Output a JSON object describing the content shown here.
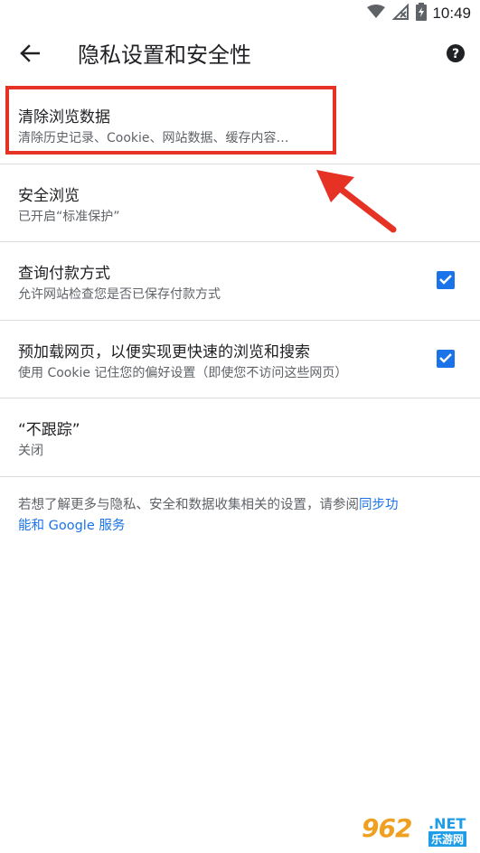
{
  "status_bar": {
    "time": "10:49",
    "icons": [
      "wifi-icon",
      "no-signal-icon",
      "battery-charging-icon"
    ]
  },
  "app_bar": {
    "back_icon": "arrow-left-icon",
    "title": "隐私设置和安全性",
    "help_icon": "help-circle-icon"
  },
  "settings": [
    {
      "title": "清除浏览数据",
      "subtitle": "清除历史记录、Cookie、网站数据、缓存内容…",
      "has_checkbox": false
    },
    {
      "title": "安全浏览",
      "subtitle": "已开启“标准保护”",
      "has_checkbox": false
    },
    {
      "title": "查询付款方式",
      "subtitle": "允许网站检查您是否已保存付款方式",
      "has_checkbox": true,
      "checked": true
    },
    {
      "title": "预加载网页，以便实现更快速的浏览和搜索",
      "subtitle": "使用 Cookie 记住您的偏好设置（即使您不访问这些网页）",
      "has_checkbox": true,
      "checked": true
    },
    {
      "title": "“不跟踪”",
      "subtitle": "关闭",
      "has_checkbox": false
    }
  ],
  "footer": {
    "text": "若想了解更多与隐私、安全和数据收集相关的设置，请参阅",
    "link_part1": "同步功",
    "link_part2": "能和 Google 服务"
  },
  "watermark": {
    "number": "962",
    "domain": ".NET",
    "cn": "乐游网"
  },
  "colors": {
    "accent": "#1a73e8",
    "highlight": "#e53225",
    "divider": "#dadce0"
  }
}
